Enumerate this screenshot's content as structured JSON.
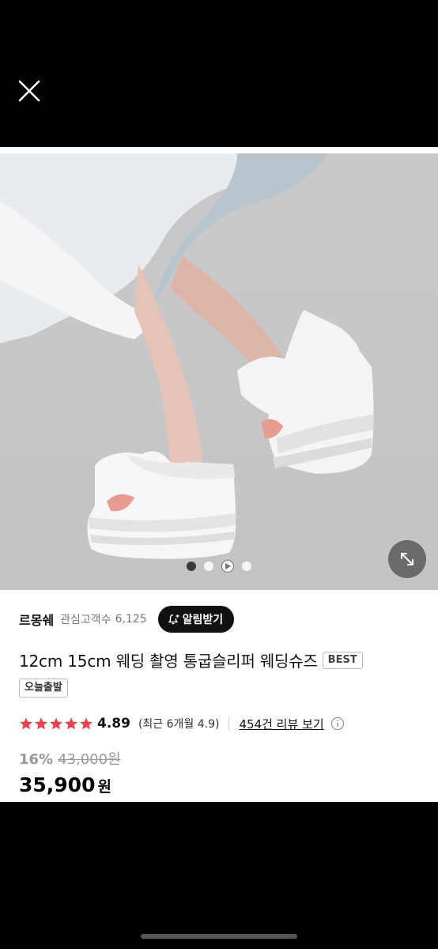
{
  "header": {
    "close_icon": "close-icon"
  },
  "gallery": {
    "dots": [
      "active",
      "inactive",
      "video",
      "inactive"
    ],
    "expand_icon": "expand-arrows-icon"
  },
  "seller": {
    "name": "르몽쉐",
    "follower_label": "관심고객수",
    "follower_count": "6,125",
    "alert_button": "알림받기"
  },
  "product": {
    "title": "12cm 15cm 웨딩 촬영 통굽슬리퍼 웨딩슈즈",
    "badge": "BEST",
    "shipping_badge": "오늘출발"
  },
  "rating": {
    "stars": 5,
    "value": "4.89",
    "recent": "(최근 6개월 4.9)",
    "review_link": "454건 리뷰 보기",
    "star_color": "#e8424f"
  },
  "price": {
    "discount_rate": "16%",
    "original": "43,000원",
    "sale": "35,900",
    "currency": "원"
  }
}
